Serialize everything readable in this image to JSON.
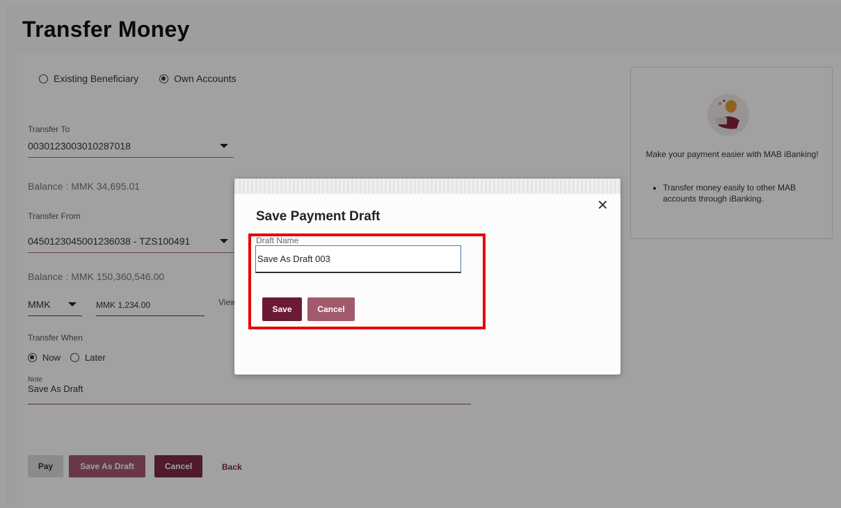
{
  "page": {
    "title": "Transfer Money"
  },
  "beneficiary_type": {
    "options": [
      "Existing Beneficiary",
      "Own Accounts"
    ],
    "selected": "Own Accounts"
  },
  "transfer_to": {
    "label": "Transfer To",
    "value": "0030123003010287018",
    "balance": "Balance : MMK 34,695.01"
  },
  "transfer_from": {
    "label": "Transfer From",
    "value": "0450123045001236038 - TZS100491",
    "balance": "Balance : MMK 150,360,546.00"
  },
  "amount": {
    "currency": "MMK",
    "value": "MMK 1,234.00",
    "view_link": "View"
  },
  "transfer_when": {
    "label": "Transfer When",
    "options": [
      "Now",
      "Later"
    ],
    "selected": "Now"
  },
  "note": {
    "label": "Note",
    "value": "Save As Draft"
  },
  "actions": {
    "pay": "Pay",
    "save_as_draft": "Save As Draft",
    "cancel": "Cancel",
    "back": "Back"
  },
  "info_card": {
    "title": "Make your payment easier with MAB iBanking!",
    "bullets": [
      "Transfer money easily to other MAB accounts through iBanking."
    ]
  },
  "modal": {
    "title": "Save Payment Draft",
    "close_icon": "close-icon",
    "field_label": "Draft Name",
    "field_value": "Save As Draft 003",
    "save_label": "Save",
    "cancel_label": "Cancel",
    "highlight_color": "#e60000"
  },
  "colors": {
    "brand": "#7c2a47",
    "accent_light": "#a55a6f"
  }
}
